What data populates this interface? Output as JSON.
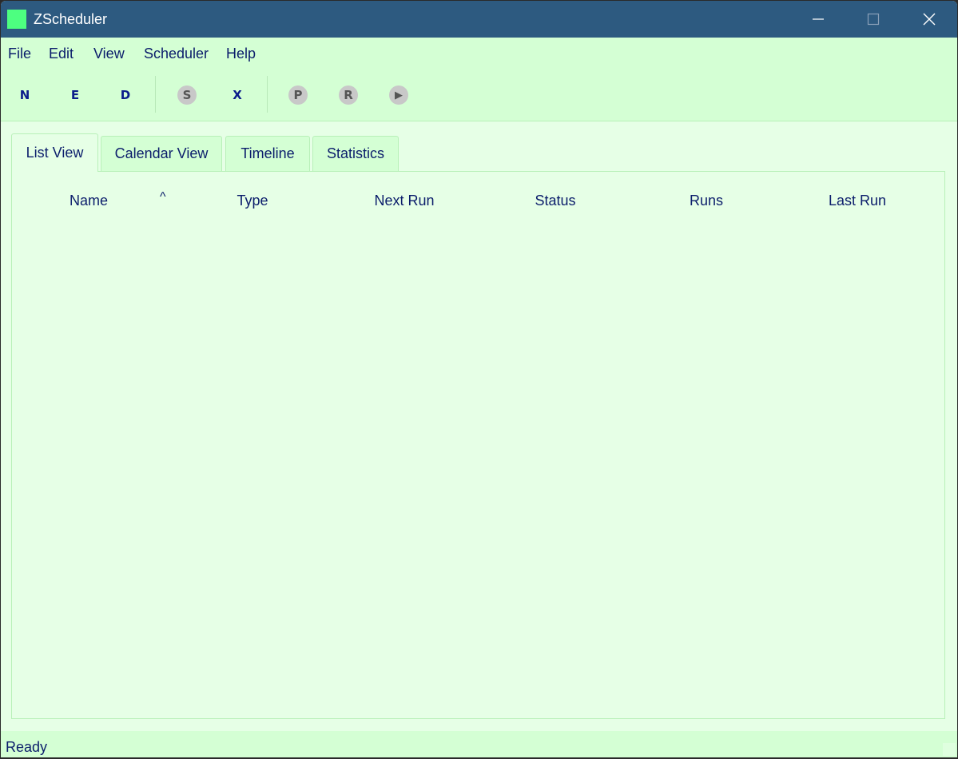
{
  "window": {
    "title": "ZScheduler",
    "accent": "#2d5a80",
    "icon_color": "#4dff80"
  },
  "menu": {
    "items": [
      {
        "label": "File"
      },
      {
        "label": "Edit"
      },
      {
        "label": "View"
      },
      {
        "label": "Scheduler"
      },
      {
        "label": "Help"
      }
    ]
  },
  "toolbar": {
    "new": "N",
    "edit": "E",
    "delete": "D",
    "start": "S",
    "stop": "X",
    "pause": "P",
    "resume": "R",
    "run": "▶"
  },
  "tabs": [
    {
      "label": "List View",
      "active": true
    },
    {
      "label": "Calendar View",
      "active": false
    },
    {
      "label": "Timeline",
      "active": false
    },
    {
      "label": "Statistics",
      "active": false
    }
  ],
  "table": {
    "columns": [
      {
        "label": "Name"
      },
      {
        "label": "Type"
      },
      {
        "label": "Next Run"
      },
      {
        "label": "Status"
      },
      {
        "label": "Runs"
      },
      {
        "label": "Last Run"
      }
    ],
    "sort_indicator": "^",
    "rows": []
  },
  "status": {
    "text": "Ready"
  },
  "colors": {
    "background": "#e6ffe6",
    "bars": "#d4ffd4",
    "text": "#0b1d6b"
  }
}
